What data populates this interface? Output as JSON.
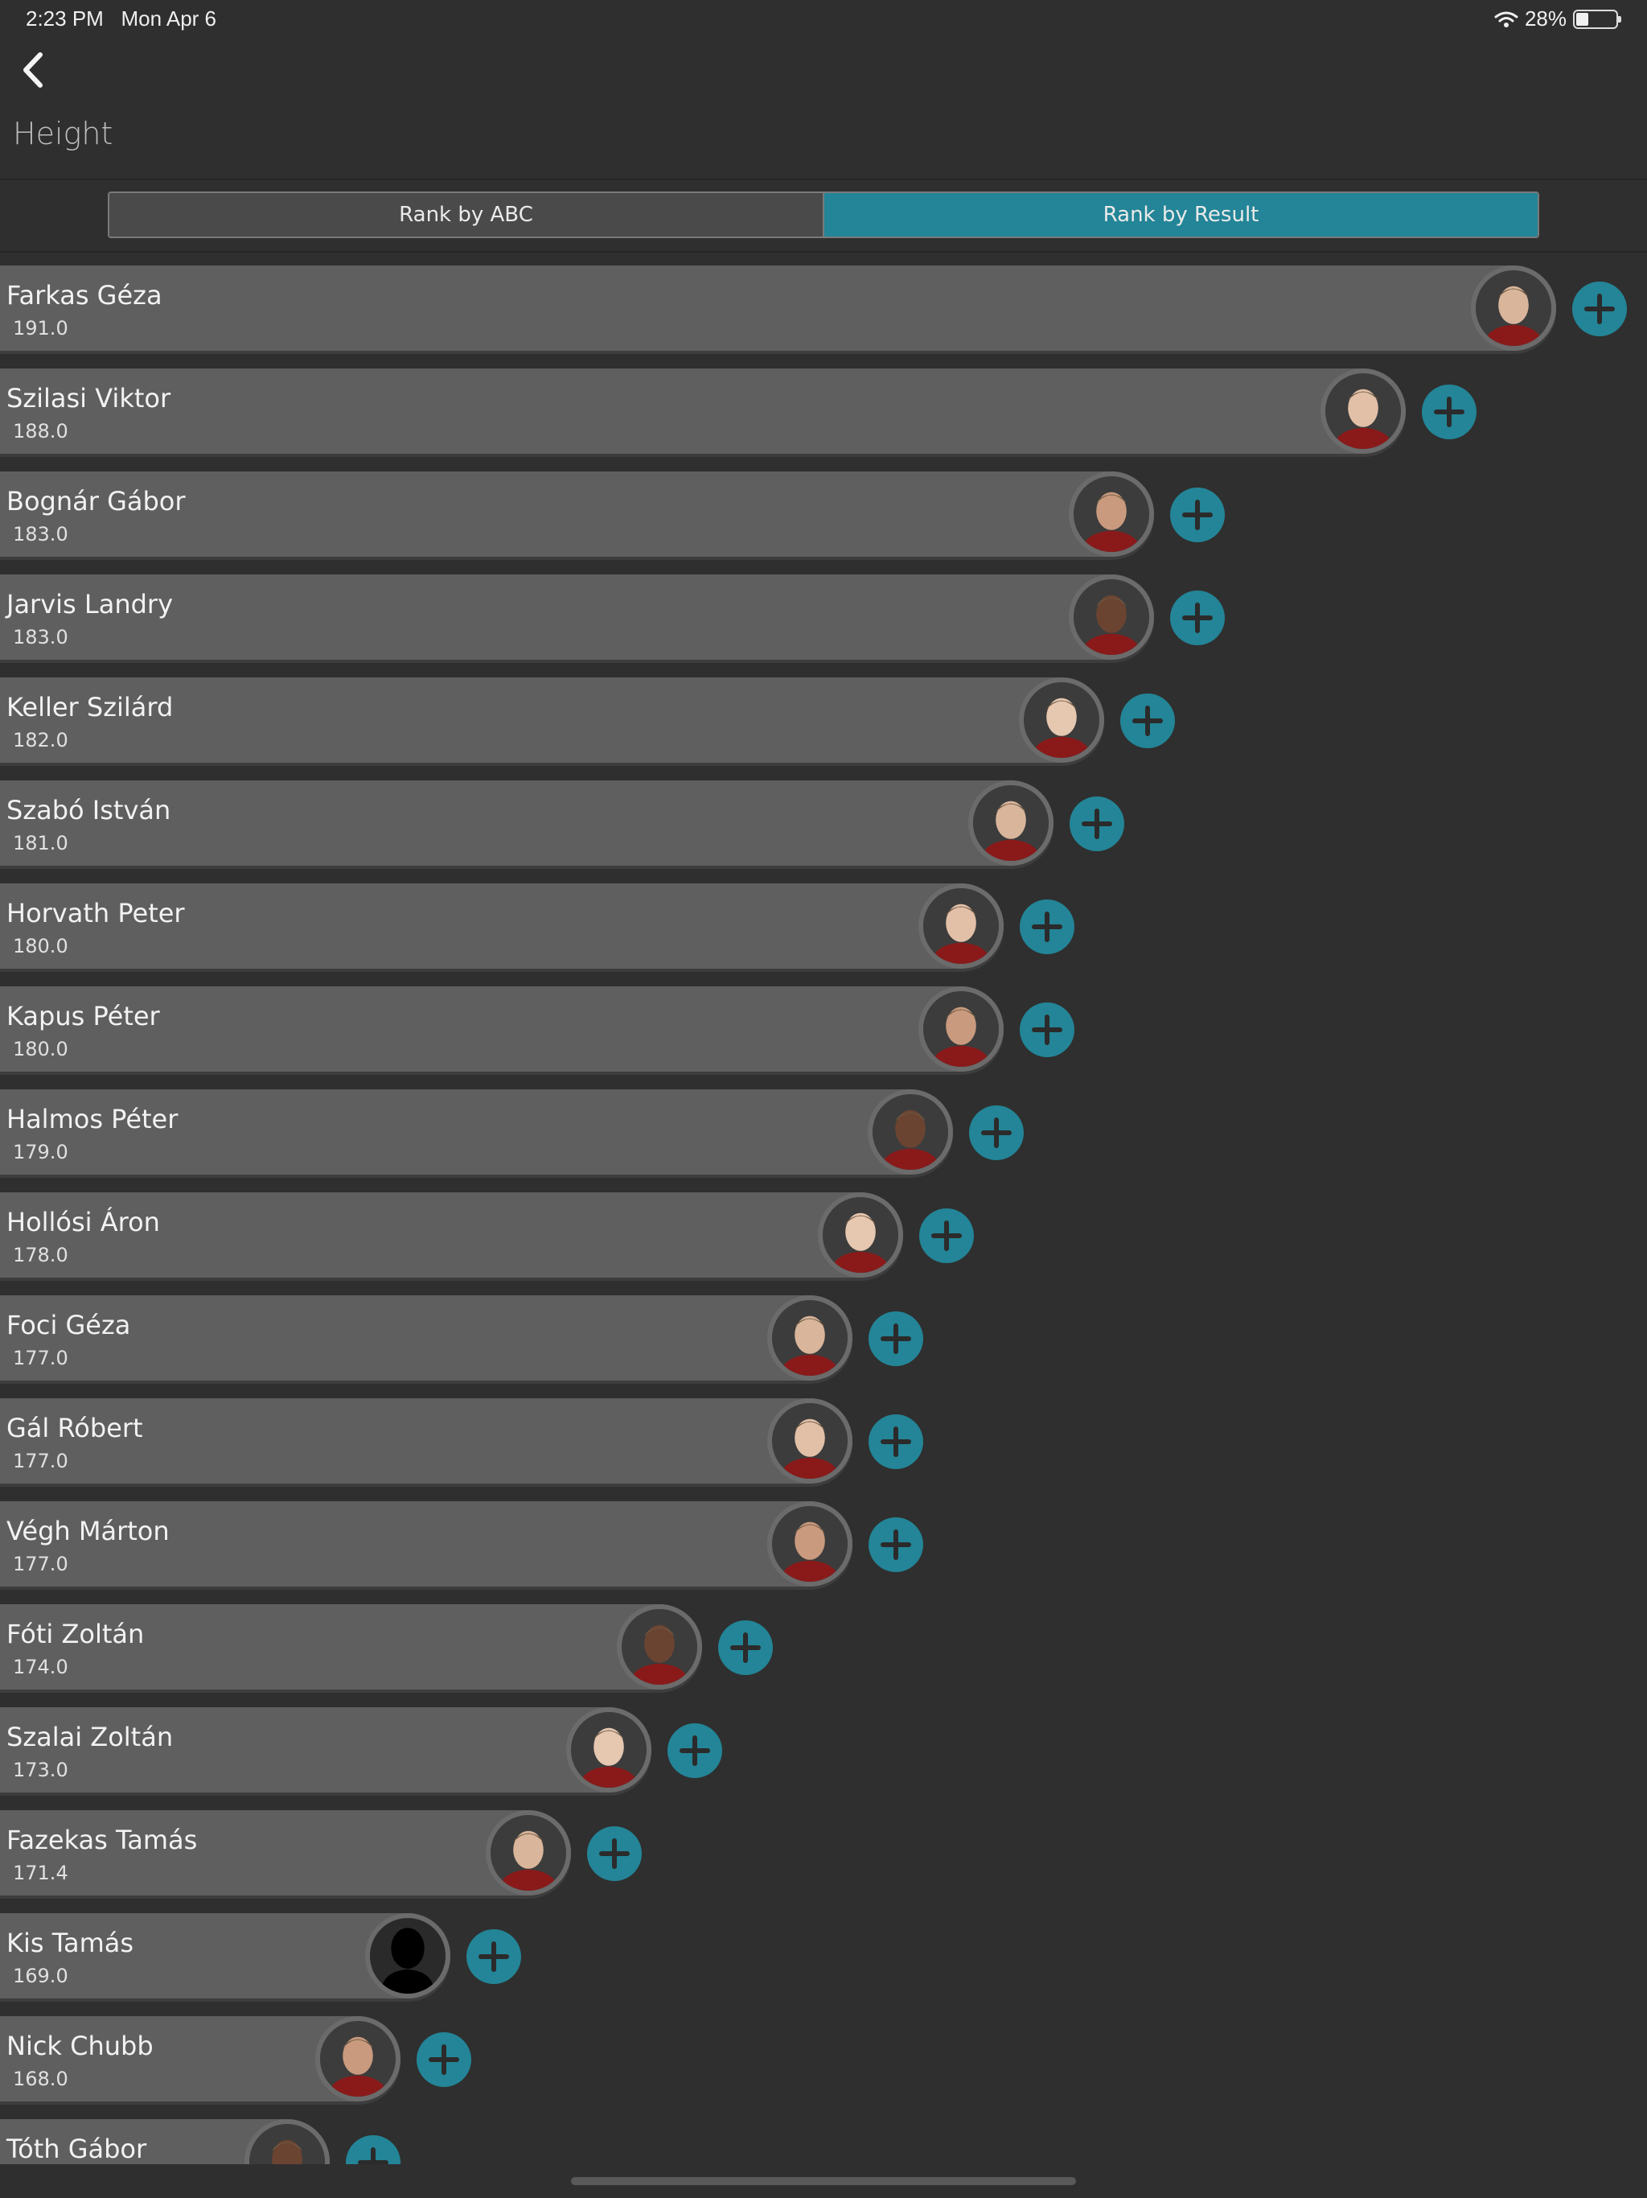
{
  "status_bar": {
    "time": "2:23 PM",
    "date": "Mon Apr 6",
    "battery": "28%"
  },
  "header": {
    "back_icon": "chevron-left-icon",
    "title": "Height"
  },
  "segmented": {
    "options": [
      "Rank by ABC",
      "Rank by Result"
    ],
    "selected": "Rank by Result"
  },
  "colors": {
    "accent": "#238597",
    "background": "#2f2f2f",
    "bar": "#5f5f5f"
  },
  "ranking": {
    "max_value": 191.0,
    "players": [
      {
        "name": "Farkas Géza",
        "value": "191.0",
        "avatar": "player-photo"
      },
      {
        "name": "Szilasi Viktor",
        "value": "188.0",
        "avatar": "player-photo"
      },
      {
        "name": "Bognár Gábor",
        "value": "183.0",
        "avatar": "player-photo"
      },
      {
        "name": "Jarvis Landry",
        "value": "183.0",
        "avatar": "player-photo"
      },
      {
        "name": "Keller Szilárd",
        "value": "182.0",
        "avatar": "player-photo"
      },
      {
        "name": "Szabó István",
        "value": "181.0",
        "avatar": "player-photo"
      },
      {
        "name": "Horvath Peter",
        "value": "180.0",
        "avatar": "player-photo"
      },
      {
        "name": "Kapus Péter",
        "value": "180.0",
        "avatar": "player-photo"
      },
      {
        "name": "Halmos Péter",
        "value": "179.0",
        "avatar": "player-photo"
      },
      {
        "name": "Hollósi Áron",
        "value": "178.0",
        "avatar": "player-photo"
      },
      {
        "name": "Foci Géza",
        "value": "177.0",
        "avatar": "player-photo"
      },
      {
        "name": "Gál Róbert",
        "value": "177.0",
        "avatar": "player-photo"
      },
      {
        "name": "Végh Márton",
        "value": "177.0",
        "avatar": "player-photo"
      },
      {
        "name": "Fóti Zoltán",
        "value": "174.0",
        "avatar": "player-photo"
      },
      {
        "name": "Szalai Zoltán",
        "value": "173.0",
        "avatar": "player-photo"
      },
      {
        "name": "Fazekas Tamás",
        "value": "171.4",
        "avatar": "player-photo"
      },
      {
        "name": "Kis Tamás",
        "value": "169.0",
        "avatar": "silhouette-placeholder"
      },
      {
        "name": "Nick Chubb",
        "value": "168.0",
        "avatar": "player-photo"
      },
      {
        "name": "Tóth Gábor",
        "value": "",
        "avatar": "player-photo"
      }
    ]
  }
}
